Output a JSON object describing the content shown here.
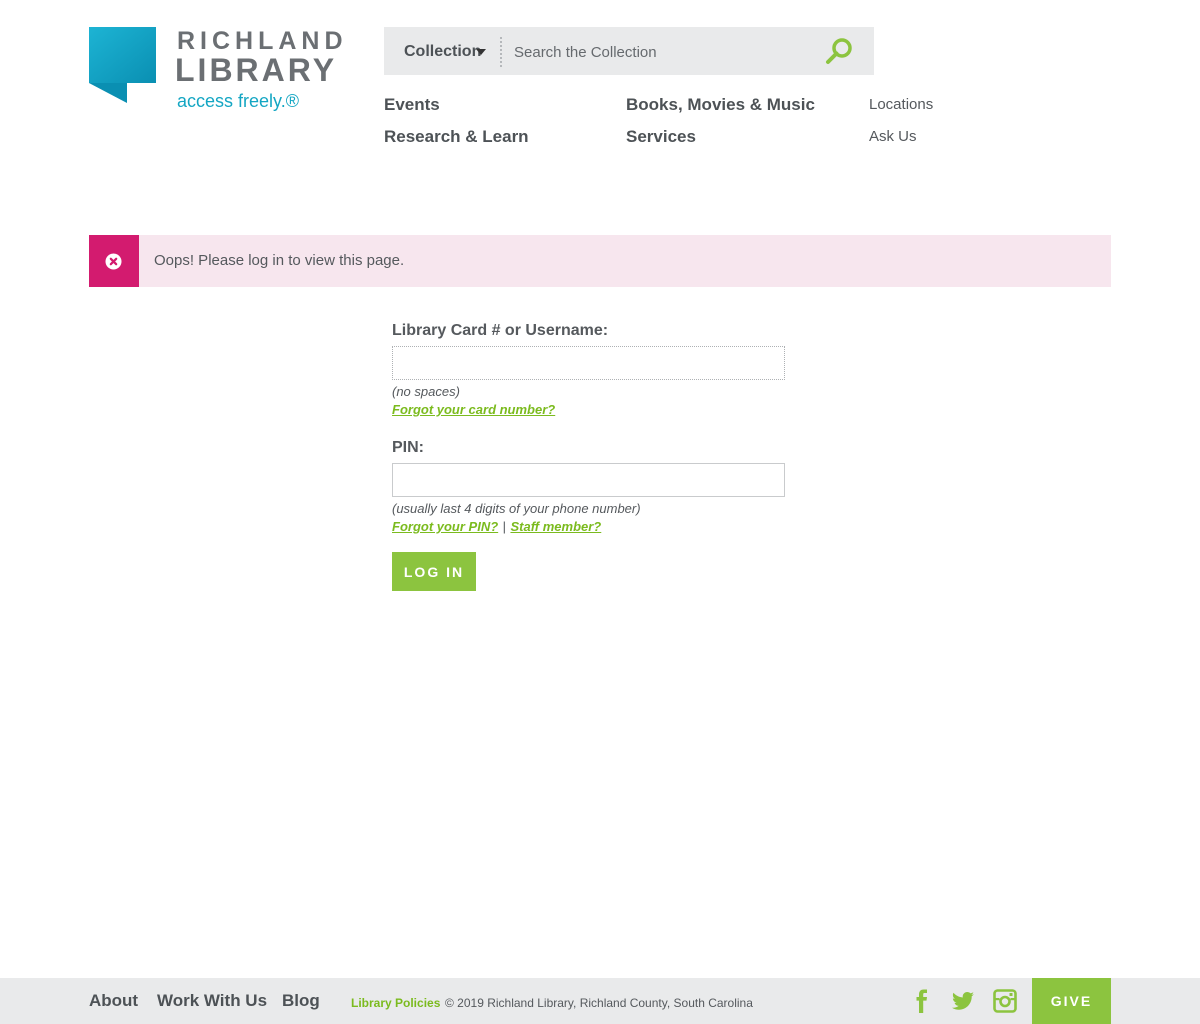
{
  "logo": {
    "word1": "RICHLAND",
    "word2": "LIBRARY",
    "tagline": "access freely.®",
    "colors": {
      "brand_teal": "#14a6c3",
      "brand_gray": "#6b6f73"
    }
  },
  "search": {
    "scope_label": "Collection",
    "placeholder": "Search the Collection",
    "icon": "search-icon"
  },
  "nav": {
    "events": "Events",
    "books": "Books, Movies & Music",
    "locations": "Locations",
    "research": "Research & Learn",
    "services": "Services",
    "ask": "Ask Us"
  },
  "alert": {
    "message": "Oops! Please log in to view this page.",
    "icon": "error-icon",
    "accent_color": "#d31b6f"
  },
  "form": {
    "card_label": "Library Card # or Username:",
    "card_hint": "(no spaces)",
    "card_forgot": "Forgot your card number?",
    "pin_label": "PIN:",
    "pin_hint": "(usually last 4 digits of your phone number)",
    "pin_forgot": "Forgot your PIN?",
    "separator": "|",
    "staff": "Staff member?",
    "submit": "LOG IN",
    "accent_color": "#8cc43f"
  },
  "footer": {
    "about": "About",
    "work": "Work With Us",
    "blog": "Blog",
    "policies": "Library Policies",
    "copyright": "© 2019 Richland Library, Richland County, South Carolina",
    "social": [
      "facebook-icon",
      "twitter-icon",
      "instagram-icon"
    ],
    "give": "GIVE"
  }
}
